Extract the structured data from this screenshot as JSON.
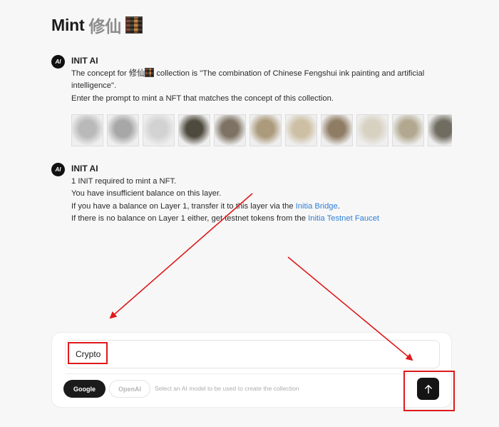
{
  "header": {
    "title_latin": "Mint",
    "title_cjk": "修仙"
  },
  "messages": [
    {
      "avatar": "AI",
      "sender": "INIT AI",
      "lines": [
        "The concept for 修仙",
        "collection is \"The combination of Chinese Fengshui ink painting and artificial",
        "intelligence\".",
        "Enter the prompt to mint a NFT that matches the concept of this collection."
      ]
    },
    {
      "avatar": "AI",
      "sender": "INIT AI",
      "lines": [
        "1 INIT required to mint a NFT.",
        "You have insufficient balance on this layer.",
        "If you have a balance on Layer 1, transfer it to this layer via the ",
        "Initia Bridge",
        ".",
        "If there is no balance on Layer 1 either, get testnet tokens from the ",
        "Initia Testnet Faucet"
      ]
    }
  ],
  "gallery": {
    "thumb_colors": [
      "#b9b9b9",
      "#a7a7a7",
      "#d2d2d2",
      "#4f4a3e",
      "#7d7263",
      "#ab9a7b",
      "#cdbfa4",
      "#8f7c64",
      "#d7d1c2",
      "#b2a890",
      "#706c60",
      "#e1dfda"
    ]
  },
  "composer": {
    "prompt_value": "Crypto",
    "model_google": "Google",
    "model_openai": "OpenAI",
    "model_hint": "Select an AI model to be used to create the collection",
    "send_icon": "arrow-up-icon"
  },
  "annotations": {
    "color": "#e0191b"
  }
}
